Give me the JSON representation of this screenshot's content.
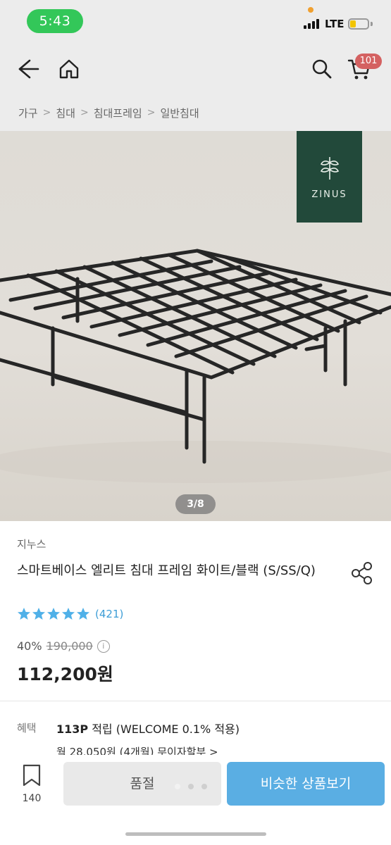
{
  "status_bar": {
    "time": "5:43",
    "network": "LTE"
  },
  "header": {
    "cart_count": "101",
    "icons": [
      "back-icon",
      "home-icon",
      "search-icon",
      "cart-icon"
    ]
  },
  "breadcrumb": [
    "가구",
    "침대",
    "침대프레임",
    "일반침대"
  ],
  "gallery": {
    "brand_logo_text": "ZINUS",
    "counter": "3/8"
  },
  "product": {
    "brand": "지누스",
    "title": "스마트베이스 엘리트 침대 프레임 화이트/블랙 (S/SS/Q)",
    "rating_stars": 5,
    "review_count": "(421)",
    "discount": "40%",
    "original_price": "190,000",
    "sale_price": "112,200원"
  },
  "benefits": {
    "label": "혜택",
    "points": "113P",
    "points_suffix": " 적립 (WELCOME 0.1% 적용)",
    "installment": "월 28,050원 (4개월) 무이자할부 >"
  },
  "bottom_bar": {
    "wish_count": "140",
    "soldout_label": "품절",
    "similar_label": "비슷한 상품보기"
  },
  "colors": {
    "accent_blue": "#5aaee3",
    "badge_red": "#d46161",
    "brand_green": "#22493a",
    "star_blue": "#4fb0e8"
  }
}
